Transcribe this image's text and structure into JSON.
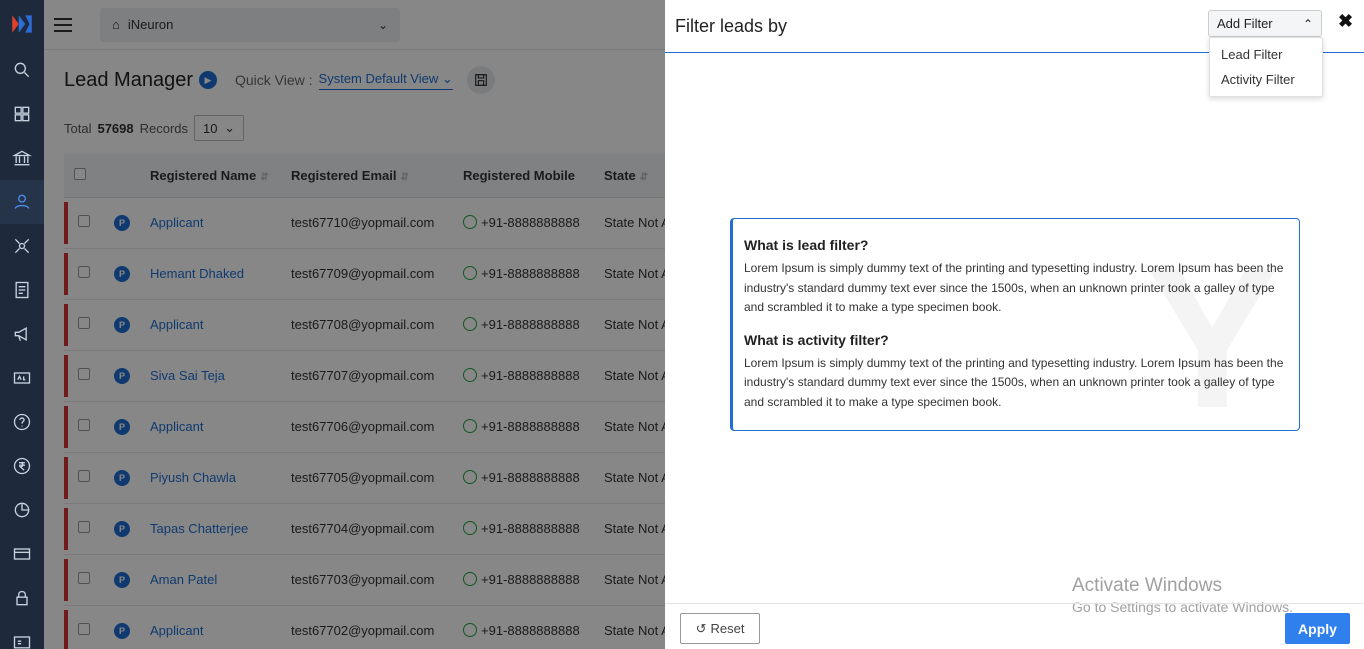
{
  "topbar": {
    "org_name": "iNeuron"
  },
  "page": {
    "title": "Lead Manager",
    "quick_view_label": "Quick View :",
    "quick_view_value": "System Default View",
    "total_prefix": "Total",
    "total_count": "57698",
    "total_suffix": "Records",
    "page_size": "10"
  },
  "table": {
    "columns": [
      "Registered Name",
      "Registered Email",
      "Registered Mobile",
      "State"
    ],
    "badge": "P",
    "rows": [
      {
        "name": "Applicant",
        "email": "test67710@yopmail.com",
        "mobile": "+91-8888888888",
        "state": "State Not Av"
      },
      {
        "name": "Hemant Dhaked",
        "email": "test67709@yopmail.com",
        "mobile": "+91-8888888888",
        "state": "State Not Av"
      },
      {
        "name": "Applicant",
        "email": "test67708@yopmail.com",
        "mobile": "+91-8888888888",
        "state": "State Not Av"
      },
      {
        "name": "Siva Sai Teja",
        "email": "test67707@yopmail.com",
        "mobile": "+91-8888888888",
        "state": "State Not Av"
      },
      {
        "name": "Applicant",
        "email": "test67706@yopmail.com",
        "mobile": "+91-8888888888",
        "state": "State Not Av"
      },
      {
        "name": "Piyush Chawla",
        "email": "test67705@yopmail.com",
        "mobile": "+91-8888888888",
        "state": "State Not Av"
      },
      {
        "name": "Tapas Chatterjee",
        "email": "test67704@yopmail.com",
        "mobile": "+91-8888888888",
        "state": "State Not Av"
      },
      {
        "name": "Aman Patel",
        "email": "test67703@yopmail.com",
        "mobile": "+91-8888888888",
        "state": "State Not Av"
      },
      {
        "name": "Applicant",
        "email": "test67702@yopmail.com",
        "mobile": "+91-8888888888",
        "state": "State Not Av"
      }
    ]
  },
  "panel": {
    "title": "Filter leads by",
    "add_filter_label": "Add Filter",
    "close_glyph": "✖",
    "dropdown_options": [
      "Lead Filter",
      "Activity Filter"
    ],
    "info": [
      {
        "question": "What is lead filter?",
        "answer": "Lorem Ipsum is simply dummy text of the printing and typesetting industry. Lorem Ipsum has been the industry's standard dummy text ever since the 1500s, when an unknown printer took a galley of type and scrambled it to make a type specimen book."
      },
      {
        "question": "What is activity filter?",
        "answer": "Lorem Ipsum is simply dummy text of the printing and typesetting industry. Lorem Ipsum has been the industry's standard dummy text ever since the 1500s, when an unknown printer took a galley of type and scrambled it to make a type specimen book."
      }
    ],
    "reset_label": "Reset",
    "apply_label": "Apply"
  },
  "windows_notice": {
    "line1": "Activate Windows",
    "line2": "Go to Settings to activate Windows."
  },
  "colors": {
    "accent": "#1f6fd1",
    "rail": "#1e2a3c",
    "apply": "#2f80ed",
    "row_marker": "#d33333"
  },
  "icons": [
    "app-logo",
    "dashboard-icon",
    "institution-icon",
    "user-icon",
    "network-icon",
    "form-icon",
    "megaphone-icon",
    "ads-icon",
    "help-icon",
    "rupee-icon",
    "chart-icon",
    "card-icon",
    "lock-icon",
    "id-icon"
  ]
}
